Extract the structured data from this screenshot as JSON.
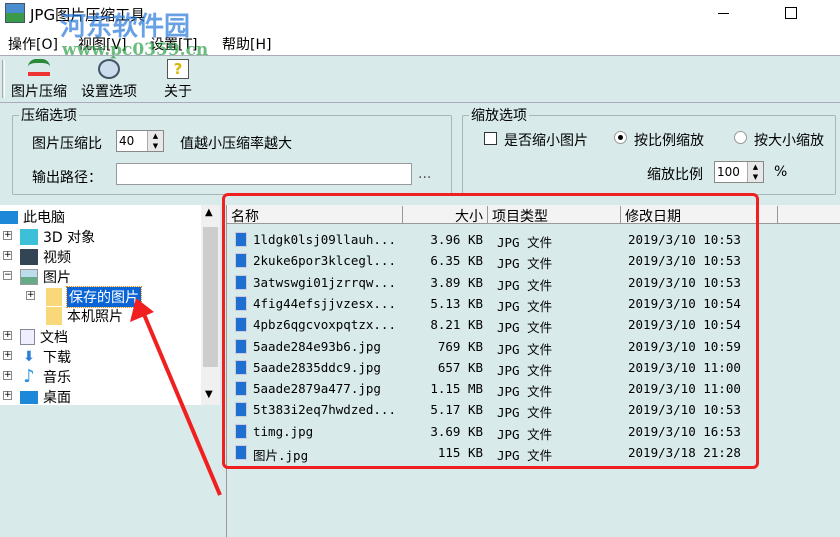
{
  "window": {
    "title": "JPG图片压缩工具"
  },
  "watermark": {
    "name": "河东软件园",
    "url": "www.pc0359.cn"
  },
  "menu": [
    "操作[O]",
    "视图[V]",
    "设置[T]",
    "帮助[H]"
  ],
  "toolbar": [
    "图片压缩",
    "设置选项",
    "关于"
  ],
  "compress": {
    "legend": "压缩选项",
    "ratio_label": "图片压缩比",
    "ratio_value": "40",
    "hint": "值越小压缩率越大",
    "output_label": "输出路径：",
    "output_value": "",
    "browse": "..."
  },
  "scale": {
    "legend": "缩放选项",
    "shrink_label": "是否缩小图片",
    "by_ratio": "按比例缩放",
    "by_size": "按大小缩放",
    "ratio_label": "缩放比例",
    "ratio_value": "100",
    "percent": "%"
  },
  "tree": {
    "root": "此电脑",
    "items": [
      "3D 对象",
      "视频",
      "图片",
      "保存的图片",
      "本机照片",
      "文档",
      "下载",
      "音乐",
      "桌面"
    ]
  },
  "list": {
    "headers": [
      "名称",
      "大小",
      "项目类型",
      "修改日期"
    ],
    "rows": [
      [
        "1ldgk0lsj09llauh...",
        "3.96 KB",
        "JPG 文件",
        "2019/3/10 10:53"
      ],
      [
        "2kuke6por3klcegl...",
        "6.35 KB",
        "JPG 文件",
        "2019/3/10 10:53"
      ],
      [
        "3atwswgi01jzrrqw...",
        "3.89 KB",
        "JPG 文件",
        "2019/3/10 10:53"
      ],
      [
        "4fig44efsjjvzesx...",
        "5.13 KB",
        "JPG 文件",
        "2019/3/10 10:54"
      ],
      [
        "4pbz6qgcvoxpqtzx...",
        "8.21 KB",
        "JPG 文件",
        "2019/3/10 10:54"
      ],
      [
        "5aade284e93b6.jpg",
        "769 KB",
        "JPG 文件",
        "2019/3/10 10:59"
      ],
      [
        "5aade2835ddc9.jpg",
        "657 KB",
        "JPG 文件",
        "2019/3/10 11:00"
      ],
      [
        "5aade2879a477.jpg",
        "1.15 MB",
        "JPG 文件",
        "2019/3/10 11:00"
      ],
      [
        "5t383i2eq7hwdzed...",
        "5.17 KB",
        "JPG 文件",
        "2019/3/10 10:53"
      ],
      [
        "timg.jpg",
        "3.69 KB",
        "JPG 文件",
        "2019/3/10 16:53"
      ],
      [
        "图片.jpg",
        "115 KB",
        "JPG 文件",
        "2019/3/18 21:28"
      ]
    ]
  }
}
